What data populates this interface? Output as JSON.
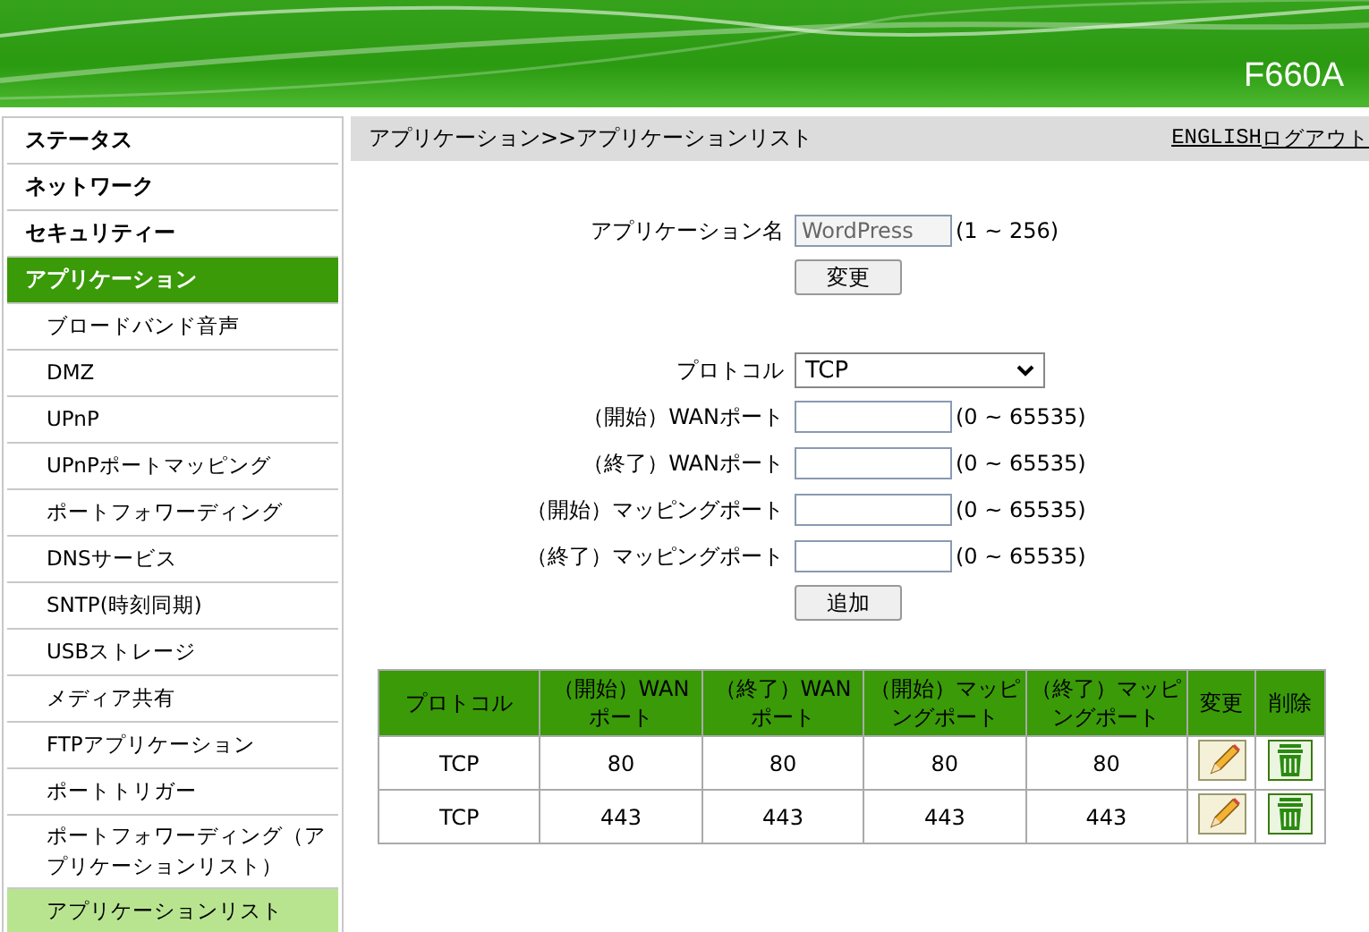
{
  "header": {
    "model": "F660A"
  },
  "sidebar": {
    "items": [
      {
        "label": "ステータス",
        "selected": false
      },
      {
        "label": "ネットワーク",
        "selected": false
      },
      {
        "label": "セキュリティー",
        "selected": false
      },
      {
        "label": "アプリケーション",
        "selected": true,
        "children": [
          {
            "label": "ブロードバンド音声",
            "selected": false
          },
          {
            "label": "DMZ",
            "selected": false
          },
          {
            "label": "UPnP",
            "selected": false
          },
          {
            "label": "UPnPポートマッピング",
            "selected": false
          },
          {
            "label": "ポートフォワーディング",
            "selected": false
          },
          {
            "label": "DNSサービス",
            "selected": false
          },
          {
            "label": "SNTP(時刻同期)",
            "selected": false
          },
          {
            "label": "USBストレージ",
            "selected": false
          },
          {
            "label": "メディア共有",
            "selected": false
          },
          {
            "label": "FTPアプリケーション",
            "selected": false
          },
          {
            "label": "ポートトリガー",
            "selected": false
          },
          {
            "label": "ポートフォワーディング（アプリケーションリスト）",
            "selected": false
          },
          {
            "label": "アプリケーションリスト",
            "selected": true
          }
        ]
      }
    ]
  },
  "breadcrumb": "アプリケーション>>アプリケーションリスト",
  "top_links": [
    "ENGLISH",
    "ログアウト"
  ],
  "app_name": {
    "label": "アプリケーション名",
    "value": "WordPress",
    "range": "(1 ~ 256)",
    "button": "変更"
  },
  "protocol": {
    "label": "プロトコル",
    "value": "TCP"
  },
  "ports": [
    {
      "label": "（開始）WANポート",
      "range": "(0 ~ 65535)"
    },
    {
      "label": "（終了）WANポート",
      "range": "(0 ~ 65535)"
    },
    {
      "label": "（開始）マッピングポート",
      "range": "(0 ~ 65535)"
    },
    {
      "label": "（終了）マッピングポート",
      "range": "(0 ~ 65535)"
    }
  ],
  "add_button": "追加",
  "table": {
    "columns": [
      "プロトコル",
      "（開始）WANポート",
      "（終了）WANポート",
      "（開始）マッピングポート",
      "（終了）マッピングポート",
      "変更",
      "削除"
    ],
    "rows": [
      [
        "TCP",
        "80",
        "80",
        "80",
        "80"
      ],
      [
        "TCP",
        "443",
        "443",
        "443",
        "443"
      ]
    ]
  }
}
